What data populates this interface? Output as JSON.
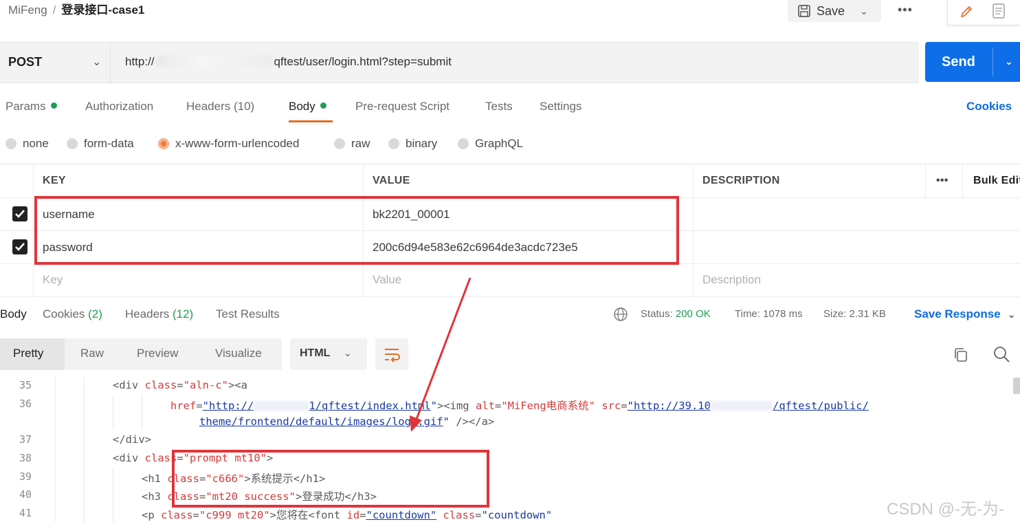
{
  "breadcrumb": {
    "workspace": "MiFeng",
    "separator": "/",
    "request_name": "登录接口-case1"
  },
  "toolbar": {
    "save_label": "Save",
    "more_icon": "ellipsis-icon",
    "edit_icon": "pencil-icon",
    "docs_icon": "document-icon"
  },
  "request": {
    "method": "POST",
    "url_prefix": "http://",
    "url_suffix": "qftest/user/login.html?step=submit",
    "send_label": "Send"
  },
  "request_tabs": [
    {
      "label": "Params",
      "dot": true
    },
    {
      "label": "Authorization",
      "dot": false
    },
    {
      "label": "Headers (10)",
      "dot": false
    },
    {
      "label": "Body",
      "dot": true,
      "active": true
    },
    {
      "label": "Pre-request Script",
      "dot": false
    },
    {
      "label": "Tests",
      "dot": false
    },
    {
      "label": "Settings",
      "dot": false
    }
  ],
  "cookies_link": "Cookies",
  "body_types": [
    {
      "label": "none",
      "selected": false
    },
    {
      "label": "form-data",
      "selected": false
    },
    {
      "label": "x-www-form-urlencoded",
      "selected": true
    },
    {
      "label": "raw",
      "selected": false
    },
    {
      "label": "binary",
      "selected": false
    },
    {
      "label": "GraphQL",
      "selected": false
    }
  ],
  "params_table": {
    "headers": {
      "key": "KEY",
      "value": "VALUE",
      "description": "DESCRIPTION",
      "more": "•••",
      "bulk": "Bulk Edit"
    },
    "rows": [
      {
        "checked": true,
        "key": "username",
        "value": "bk2201_00001",
        "description": ""
      },
      {
        "checked": true,
        "key": "password",
        "value": "200c6d94e583e62c6964de3acdc723e5",
        "description": ""
      }
    ],
    "placeholder": {
      "key": "Key",
      "value": "Value",
      "description": "Description"
    }
  },
  "response": {
    "tabs": [
      {
        "label": "Body",
        "count": "",
        "active": true
      },
      {
        "label": "Cookies ",
        "count": "(2)"
      },
      {
        "label": "Headers ",
        "count": "(12)"
      },
      {
        "label": "Test Results",
        "count": ""
      }
    ],
    "status_label": "Status:",
    "status_value": "200 OK",
    "time_label": "Time:",
    "time_value": "1078 ms",
    "size_label": "Size:",
    "size_value": "2.31 KB",
    "save_response": "Save Response",
    "formats": [
      "Pretty",
      "Raw",
      "Preview",
      "Visualize"
    ],
    "language": "HTML"
  },
  "code_lines": {
    "l35": {
      "num": "35",
      "open": "<div ",
      "attr": "class",
      "eq": "=",
      "val": "\"aln-c\"",
      "close": "><a"
    },
    "l36": {
      "num": "36",
      "attr1": "href",
      "eq": "=",
      "link1a": "\"http://",
      "link1b": "1/qftest/index.html",
      "q": "\"",
      "mid": "><img ",
      "attr2": "alt",
      "val2": "\"MiFeng电商系统\"",
      "attr3": " src",
      "link2a": "\"http://39.10",
      "link2b": "/qftest/public/"
    },
    "l36b": {
      "link": "theme/frontend/default/images/logo.gif",
      "q": "\"",
      "end": " /></a>"
    },
    "l37": {
      "num": "37",
      "text": "</div>"
    },
    "l38": {
      "num": "38",
      "open": "<div ",
      "attr": "class",
      "eq": "=",
      "val": "\"prompt mt10\"",
      "close": ">"
    },
    "l39": {
      "num": "39",
      "open": "<h1 ",
      "attr": "class",
      "eq": "=",
      "val": "\"c666\"",
      "text": ">系统提示</h1>"
    },
    "l40": {
      "num": "40",
      "open": "<h3 ",
      "attr": "class",
      "eq": "=",
      "val": "\"mt20 success\"",
      "text": ">登录成功</h3>"
    },
    "l41": {
      "num": "41",
      "open": "<p ",
      "attr": "class",
      "eq": "=",
      "val": "\"c999 mt20\"",
      "text": ">您将在<font ",
      "attr2": "id",
      "val2": "\"countdown\"",
      "attr3": " class",
      "val3": "\"countdown\""
    }
  },
  "watermark": "CSDN @-无-为-",
  "colors": {
    "send_blue": "#0d6ee8",
    "accent_orange": "#e56b22",
    "status_green": "#1e9e51",
    "annotation_red": "#e0343a"
  }
}
